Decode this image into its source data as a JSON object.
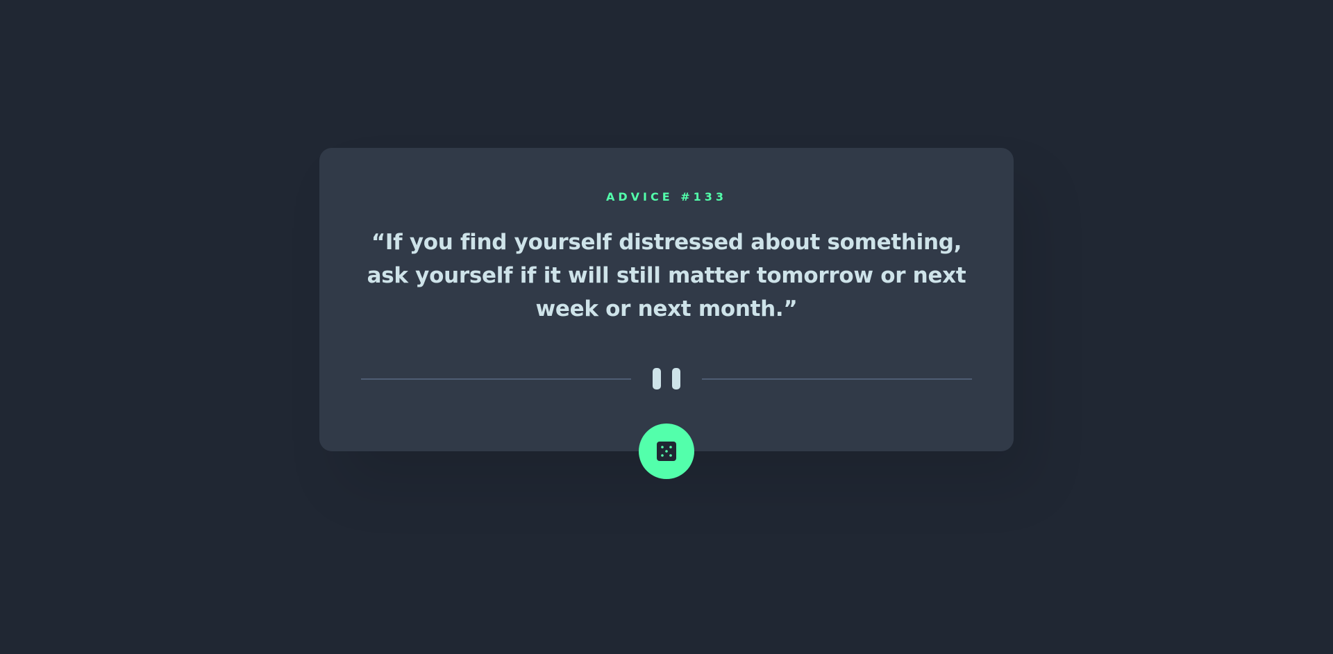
{
  "advice": {
    "label": "ADVICE #133",
    "quote": "“If you find yourself distressed about something, ask yourself if it will still matter tomorrow or next week or next month.”"
  },
  "colors": {
    "background": "#202733",
    "card": "#313a48",
    "accent": "#53ffab",
    "text": "#cee3e9",
    "divider": "#4f5d74"
  },
  "icons": {
    "divider": "pause-icon",
    "button": "dice-icon"
  }
}
